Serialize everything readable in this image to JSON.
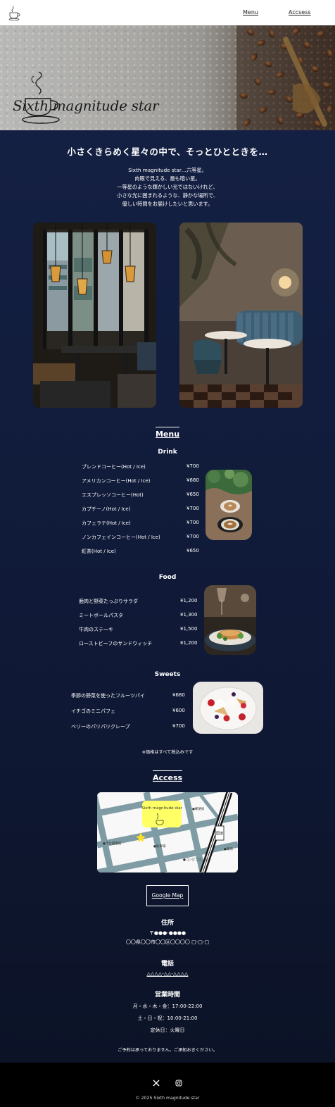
{
  "header": {
    "nav": [
      {
        "label": "Menu"
      },
      {
        "label": "Accsess"
      }
    ]
  },
  "hero": {
    "title": "Sixth magnitude star"
  },
  "intro": {
    "catch": "小さくきらめく星々の中で、そっとひとときを…",
    "lines": [
      "Sixth magnitude star…六等星。",
      "肉眼で見える、最も暗い星。",
      "一等星のような輝かしい光ではないけれど、",
      "小さな光に囲まれるような、静かな場所で、",
      "優しい時間をお届けしたいと思います。"
    ]
  },
  "menu": {
    "title": "Menu",
    "drink": {
      "title": "Drink",
      "items": [
        {
          "name": "ブレンドコーヒー(Hot / Ice)",
          "price": "¥700"
        },
        {
          "name": "アメリカンコーヒー(Hot / Ice)",
          "price": "¥680"
        },
        {
          "name": "エスプレッソコーヒー(Hot)",
          "price": "¥650"
        },
        {
          "name": "カプチーノ(Hot / Ice)",
          "price": "¥700"
        },
        {
          "name": "カフェラテ(Hot / Ice)",
          "price": "¥700"
        },
        {
          "name": "ノンカフェインコーヒー(Hot / Ice)",
          "price": "¥700"
        },
        {
          "name": "紅茶(Hot / Ice)",
          "price": "¥650"
        }
      ]
    },
    "food": {
      "title": "Food",
      "items": [
        {
          "name": "鹿肉と野菜たっぷりサラダ",
          "price": "¥1,200"
        },
        {
          "name": "ミートボールパスタ",
          "price": "¥1,300"
        },
        {
          "name": "牛肉のステーキ",
          "price": "¥1,500"
        },
        {
          "name": "ローストビーフのサンドウィッチ",
          "price": "¥1,200"
        }
      ]
    },
    "sweets": {
      "title": "Sweets",
      "items": [
        {
          "name": "季節の野菜を使ったフルーツパイ",
          "price": "¥680"
        },
        {
          "name": "イチゴのミニパフェ",
          "price": "¥600"
        },
        {
          "name": "ベリーのパリパリクレープ",
          "price": "¥700"
        }
      ]
    },
    "tax_note": "※価格はすべて税込みです"
  },
  "access": {
    "title": "Access",
    "map": {
      "shop_name": "Sixth magnitude star",
      "labels": [
        "●郵便局",
        "●市立図書館",
        "●駐車場",
        "●コンビニエンス",
        "●薬局",
        "国道"
      ]
    },
    "google_map": "Google Map",
    "address_title": "住所",
    "postal": "〒●●●-●●●●",
    "address": "〇〇県〇〇市〇〇区〇〇〇〇 □-□-□",
    "phone_title": "電話",
    "phone": "△△△△-△△-△△△△",
    "hours_title": "営業時間",
    "hours": [
      "月・水・木・金：17:00-22:00",
      "土・日・祝：10:00-21:00",
      "定休日：火曜日"
    ],
    "reservation_note": "ご予約は承っておりません。ご承知おきください。"
  },
  "footer": {
    "social_x": "X",
    "social_instagram": "instagram",
    "copyright": "© 2025 Sixth magnitude star"
  },
  "colors": {
    "bg_navy": "#142043",
    "footer": "#000000",
    "map_road": "#7f9ca5",
    "map_badge": "#ffff66"
  }
}
